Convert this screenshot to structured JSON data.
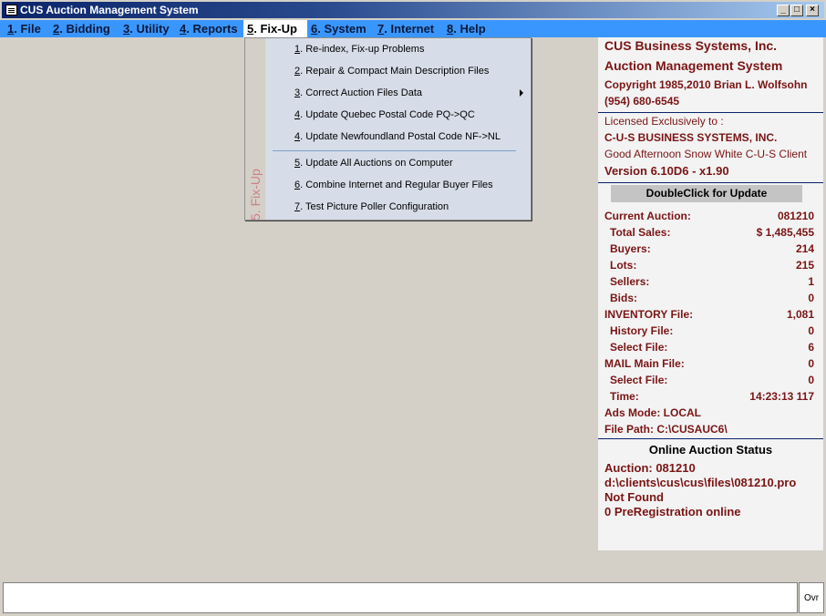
{
  "window": {
    "title": "CUS Auction Management System",
    "min_label": "_",
    "max_label": "□",
    "close_label": "×"
  },
  "menu": [
    {
      "num": "1",
      "label": ". File"
    },
    {
      "num": "2",
      "label": ". Bidding"
    },
    {
      "num": "3",
      "label": ". Utility"
    },
    {
      "num": "4",
      "label": ". Reports"
    },
    {
      "num": "5",
      "label": ". Fix-Up",
      "active": true
    },
    {
      "num": "6",
      "label": ". System"
    },
    {
      "num": "7",
      "label": ". Internet"
    },
    {
      "num": "8",
      "label": ". Help"
    }
  ],
  "fixup_menu": {
    "strip_label": "5. Fix-Up",
    "items": [
      {
        "num": "1",
        "label": ". Re-index, Fix-up Problems"
      },
      {
        "num": "2",
        "label": ". Repair & Compact Main Description Files"
      },
      {
        "num": "3",
        "label": ". Correct Auction Files Data",
        "submenu": true
      },
      {
        "num": "4",
        "label": ". Update Quebec Postal Code PQ->QC"
      },
      {
        "num": "4",
        "label": ". Update Newfoundland Postal Code NF->NL"
      },
      {
        "num": "5",
        "label": ". Update All Auctions on Computer"
      },
      {
        "num": "6",
        "label": ". Combine Internet and Regular Buyer Files"
      },
      {
        "num": "7",
        "label": ". Test Picture Poller Configuration"
      }
    ]
  },
  "info_panel": {
    "company": "CUS Business Systems, Inc.",
    "product": "Auction Management System",
    "copyright": "Copyright 1985,2010 Brian L. Wolfsohn",
    "phone": "(954) 680-6545",
    "licensed_to_label": "Licensed Exclusively to :",
    "licensee": "C-U-S BUSINESS SYSTEMS, INC.",
    "greeting": "Good Afternoon Snow White C-U-S Client",
    "version": "Version 6.10D6 - x1.90",
    "update_button": "DoubleClick for Update",
    "stats": [
      {
        "label": "Current Auction:",
        "value": "081210",
        "indent": false
      },
      {
        "label": "Total Sales:",
        "value": "$ 1,485,455",
        "indent": true
      },
      {
        "label": "Buyers:",
        "value": "214",
        "indent": true
      },
      {
        "label": "Lots:",
        "value": "215",
        "indent": true
      },
      {
        "label": "Sellers:",
        "value": "1",
        "indent": true
      },
      {
        "label": "Bids:",
        "value": "0",
        "indent": true
      },
      {
        "label": "INVENTORY File:",
        "value": "1,081",
        "indent": false
      },
      {
        "label": "History File:",
        "value": "0",
        "indent": true
      },
      {
        "label": "Select File:",
        "value": "6",
        "indent": true
      },
      {
        "label": "MAIL Main File:",
        "value": "0",
        "indent": false
      },
      {
        "label": "Select File:",
        "value": "0",
        "indent": true
      },
      {
        "label": "Time:",
        "value": "14:23:13 117",
        "indent": true
      },
      {
        "label": "Ads Mode:  LOCAL",
        "value": "",
        "indent": false
      },
      {
        "label": "File Path:  C:\\CUSAUC6\\",
        "value": "",
        "indent": false
      }
    ],
    "online_title": "Online Auction Status",
    "online_lines": [
      "Auction: 081210",
      "d:\\clients\\cus\\cus\\files\\081210.pro",
      "Not Found",
      "0 PreRegistration online"
    ]
  },
  "status_bar": {
    "text": "",
    "mode": "Ovr"
  }
}
